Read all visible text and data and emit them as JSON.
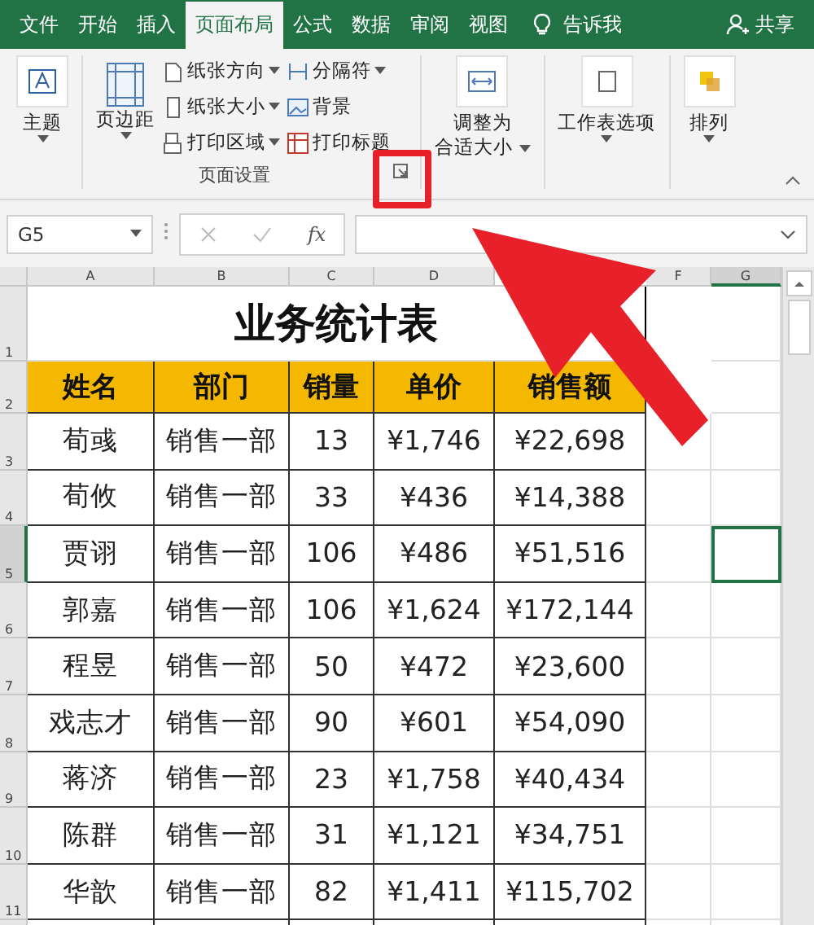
{
  "tabs": [
    {
      "label": "文件",
      "selected": false
    },
    {
      "label": "开始",
      "selected": false
    },
    {
      "label": "插入",
      "selected": false
    },
    {
      "label": "页面布局",
      "selected": true
    },
    {
      "label": "公式",
      "selected": false
    },
    {
      "label": "数据",
      "selected": false
    },
    {
      "label": "审阅",
      "selected": false
    },
    {
      "label": "视图",
      "selected": false
    }
  ],
  "tell_me": "告诉我",
  "share": "共享",
  "ribbon": {
    "themes": "主题",
    "margins": "页边距",
    "orientation": "纸张方向",
    "size": "纸张大小",
    "print_area": "打印区域",
    "breaks": "分隔符",
    "background": "背景",
    "print_titles": "打印标题",
    "group_label": "页面设置",
    "scale_to_fit": [
      "调整为",
      "合适大小"
    ],
    "sheet_options": "工作表选项",
    "arrange": "排列"
  },
  "formula_bar": {
    "name_box": "G5",
    "fx": "fx"
  },
  "sheet": {
    "columns": [
      {
        "label": "A",
        "selected": false
      },
      {
        "label": "B",
        "selected": false
      },
      {
        "label": "C",
        "selected": false
      },
      {
        "label": "D",
        "selected": false
      },
      {
        "label": "F",
        "selected": false
      },
      {
        "label": "G",
        "selected": true
      }
    ],
    "row_numbers": [
      {
        "label": "1",
        "selected": false
      },
      {
        "label": "2",
        "selected": false
      },
      {
        "label": "3",
        "selected": false
      },
      {
        "label": "4",
        "selected": false
      },
      {
        "label": "5",
        "selected": true
      },
      {
        "label": "6",
        "selected": false
      },
      {
        "label": "7",
        "selected": false
      },
      {
        "label": "8",
        "selected": false
      },
      {
        "label": "9",
        "selected": false
      },
      {
        "label": "10",
        "selected": false
      },
      {
        "label": "11",
        "selected": false
      }
    ],
    "title": "业务统计表",
    "header": [
      "姓名",
      "部门",
      "销量",
      "单价",
      "销售额"
    ],
    "rows": [
      [
        "荀彧",
        "销售一部",
        "13",
        "¥1,746",
        "¥22,698"
      ],
      [
        "荀攸",
        "销售一部",
        "33",
        "¥436",
        "¥14,388"
      ],
      [
        "贾诩",
        "销售一部",
        "106",
        "¥486",
        "¥51,516"
      ],
      [
        "郭嘉",
        "销售一部",
        "106",
        "¥1,624",
        "¥172,144"
      ],
      [
        "程昱",
        "销售一部",
        "50",
        "¥472",
        "¥23,600"
      ],
      [
        "戏志才",
        "销售一部",
        "90",
        "¥601",
        "¥54,090"
      ],
      [
        "蒋济",
        "销售一部",
        "23",
        "¥1,758",
        "¥40,434"
      ],
      [
        "陈群",
        "销售一部",
        "31",
        "¥1,121",
        "¥34,751"
      ],
      [
        "华歆",
        "销售一部",
        "82",
        "¥1,411",
        "¥115,702"
      ]
    ]
  }
}
